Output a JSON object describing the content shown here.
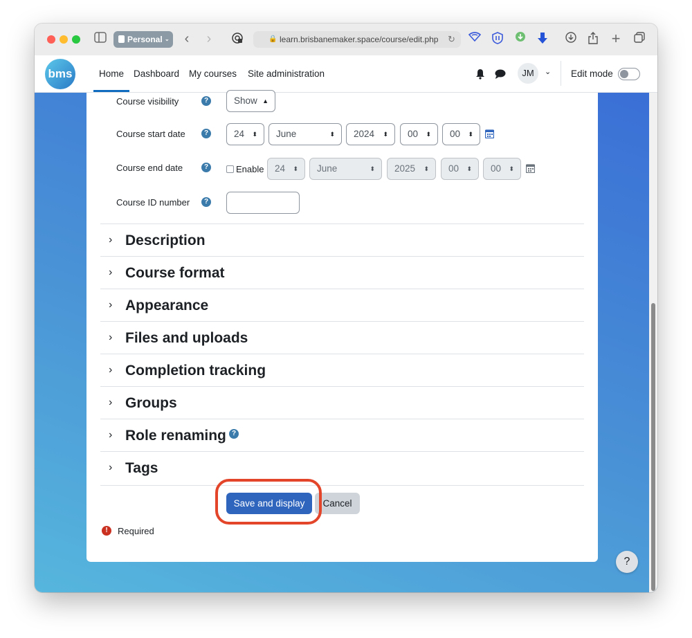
{
  "browser": {
    "profile": "Personal",
    "url": "learn.brisbanemaker.space/course/edit.php"
  },
  "nav": {
    "logo": "bms",
    "links": [
      "Home",
      "Dashboard",
      "My courses",
      "Site administration"
    ],
    "user_initials": "JM",
    "edit_mode_label": "Edit mode"
  },
  "form": {
    "visibility": {
      "label": "Course visibility",
      "value": "Show"
    },
    "start_date": {
      "label": "Course start date",
      "day": "24",
      "month": "June",
      "year": "2024",
      "hour": "00",
      "minute": "00"
    },
    "end_date": {
      "label": "Course end date",
      "enable_label": "Enable",
      "day": "24",
      "month": "June",
      "year": "2025",
      "hour": "00",
      "minute": "00"
    },
    "id_number": {
      "label": "Course ID number",
      "value": ""
    },
    "help_glyph": "?"
  },
  "sections": [
    "Description",
    "Course format",
    "Appearance",
    "Files and uploads",
    "Completion tracking",
    "Groups",
    "Role renaming",
    "Tags"
  ],
  "buttons": {
    "save": "Save and display",
    "cancel": "Cancel"
  },
  "required_label": "Required",
  "help_button": "?",
  "colors": {
    "primary": "#2f65bd",
    "highlight": "#e3452a",
    "help_icon": "#3b7bab"
  }
}
